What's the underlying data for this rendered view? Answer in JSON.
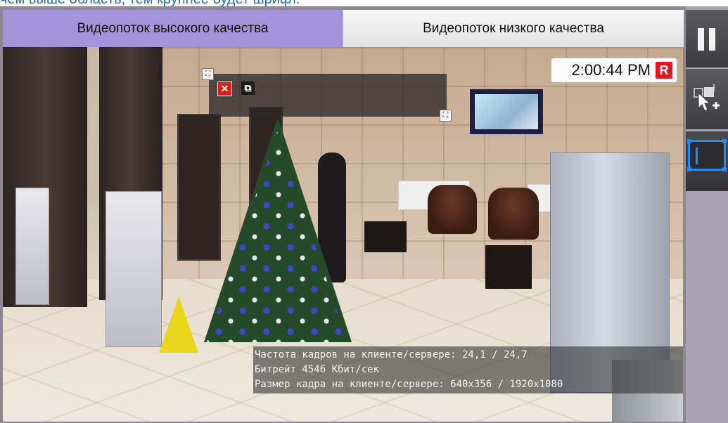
{
  "caption": "чем выше область, тем крупнее будет шрифт.",
  "tabs": {
    "high": "Видеопоток высокого качества",
    "low": "Видеопоток низкого качества"
  },
  "clock": {
    "time": "2:00:44 PM",
    "rec": "R"
  },
  "zone": {
    "handle_symbol": "⛶",
    "close_symbol": "✕",
    "resize_symbol": "⧉"
  },
  "stats": {
    "fps": "Частота кадров на клиенте/сервере: 24,1 / 24,7",
    "bitrate": "Битрейт 4546 Кбит/сек",
    "frame_size": "Размер кадра на клиенте/сервере: 640x356 / 1920x1080"
  },
  "toolbar": {
    "pause": "pause-icon",
    "add_zone": "cursor-add-zone-icon",
    "rect": "rectangle-zone-icon"
  },
  "colors": {
    "active_tab": "#a393d8",
    "record": "#e8141d",
    "selection": "#1e8cf0"
  }
}
